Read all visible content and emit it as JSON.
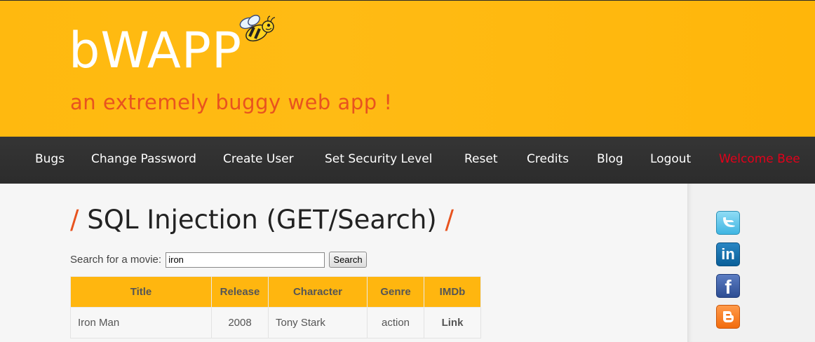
{
  "header": {
    "logo": "bWAPP",
    "tagline": "an extremely buggy web app !"
  },
  "menu": [
    {
      "label": "Bugs"
    },
    {
      "label": "Change Password"
    },
    {
      "label": "Create User"
    },
    {
      "label": "Set Security Level"
    },
    {
      "label": "Reset"
    },
    {
      "label": "Credits"
    },
    {
      "label": "Blog"
    },
    {
      "label": "Logout"
    },
    {
      "label": "Welcome Bee"
    }
  ],
  "page": {
    "title": "SQL Injection (GET/Search)",
    "slash": "/"
  },
  "search": {
    "label": "Search for a movie:",
    "value": "iron",
    "button": "Search"
  },
  "table": {
    "headers": [
      "Title",
      "Release",
      "Character",
      "Genre",
      "IMDb"
    ],
    "rows": [
      {
        "title": "Iron Man",
        "release": "2008",
        "character": "Tony Stark",
        "genre": "action",
        "imdb": "Link"
      }
    ]
  },
  "social": {
    "linkedin_glyph": "in",
    "facebook_glyph": "f"
  },
  "colors": {
    "header_bg": "#ffb90f",
    "menu_bg": "#2e2e2e",
    "accent": "#e8531f",
    "welcome": "#e2001a",
    "table_header": "#ffb60f"
  },
  "icons": [
    "bee-logo-icon",
    "twitter-icon",
    "linkedin-icon",
    "facebook-icon",
    "blogger-icon"
  ]
}
